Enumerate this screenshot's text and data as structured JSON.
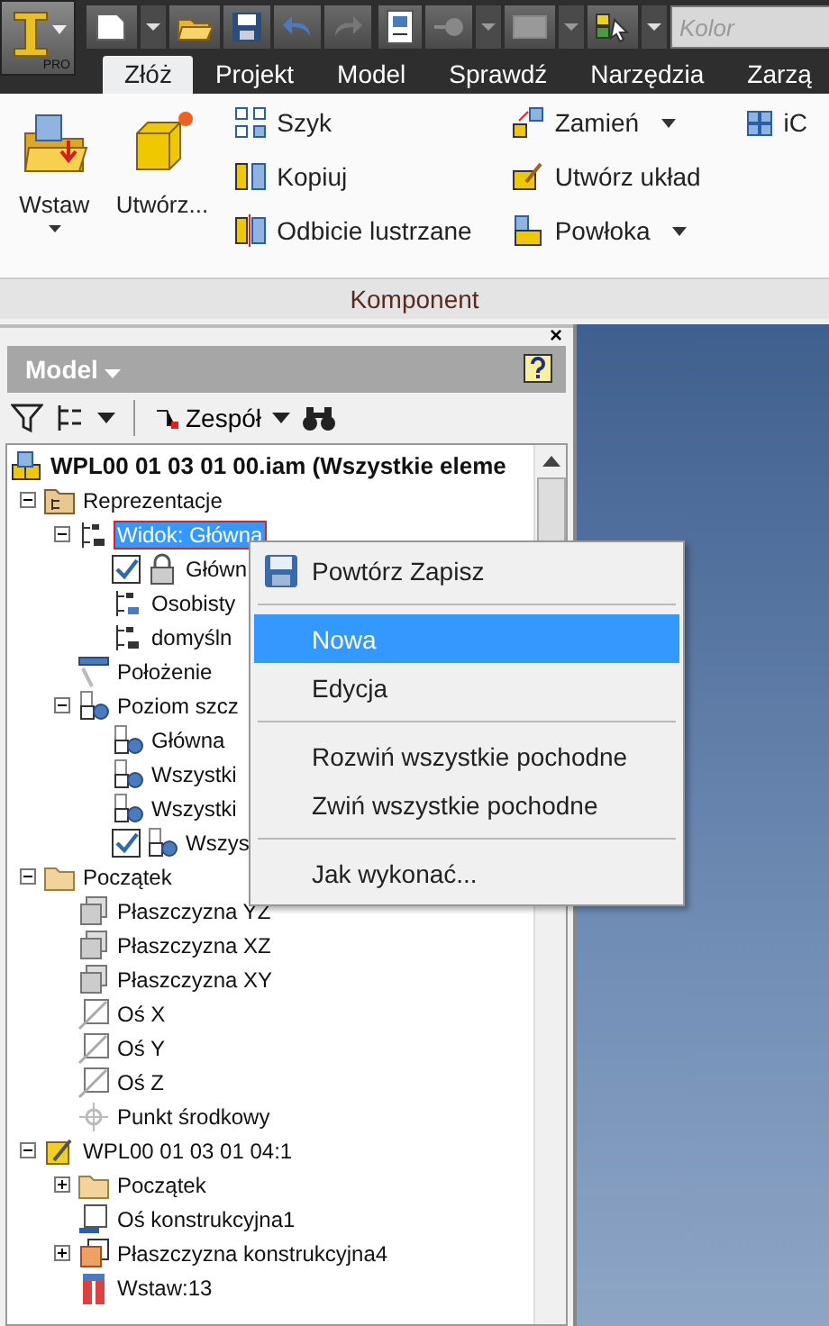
{
  "quick_access": {
    "color_field": {
      "placeholder": "Kolor"
    }
  },
  "app_button": {
    "label": "PRO"
  },
  "tabs": [
    {
      "label": "Złóż",
      "selected": true
    },
    {
      "label": "Projekt",
      "selected": false
    },
    {
      "label": "Model",
      "selected": false
    },
    {
      "label": "Sprawdź",
      "selected": false
    },
    {
      "label": "Narzędzia",
      "selected": false
    },
    {
      "label": "Zarzą",
      "selected": false
    }
  ],
  "ribbon": {
    "large_buttons": [
      {
        "label": "Wstaw",
        "dropdown": true,
        "kind": "insert"
      },
      {
        "label": "Utwórz...",
        "dropdown": false,
        "kind": "create"
      }
    ],
    "small_columns": [
      [
        {
          "label": "Szyk",
          "dropdown": false,
          "kind": "pattern"
        },
        {
          "label": "Kopiuj",
          "dropdown": false,
          "kind": "copy"
        },
        {
          "label": "Odbicie lustrzane",
          "dropdown": false,
          "kind": "mirror"
        }
      ],
      [
        {
          "label": "Zamień",
          "dropdown": true,
          "kind": "replace"
        },
        {
          "label": "Utwórz układ",
          "dropdown": false,
          "kind": "layout"
        },
        {
          "label": "Powłoka",
          "dropdown": true,
          "kind": "shell"
        }
      ],
      [
        {
          "label": "iC",
          "dropdown": false,
          "kind": "ic"
        }
      ]
    ],
    "panel_title": "Komponent"
  },
  "browser": {
    "title": "Model",
    "close": "×",
    "toolbar": {
      "mode": "Zespół"
    },
    "tree": {
      "label": "WPL00 01 03 01 00.iam (Wszystkie eleme",
      "kind": "assembly",
      "selected": false,
      "children": [
        {
          "label": "Reprezentacje",
          "kind": "reps",
          "selected": false,
          "expanded": true,
          "children": [
            {
              "label": "Widok: Główna",
              "kind": "view",
              "selected": true,
              "expanded": true,
              "children": [
                {
                  "label": "Główn",
                  "kind": "lock",
                  "selected": false,
                  "checked": true
                },
                {
                  "label": "Osobisty",
                  "kind": "view-user",
                  "selected": false
                },
                {
                  "label": "domyśln",
                  "kind": "view",
                  "selected": false
                }
              ]
            },
            {
              "label": "Położenie",
              "kind": "position",
              "selected": false
            },
            {
              "label": "Poziom szcz",
              "kind": "level",
              "selected": false,
              "expanded": true,
              "children": [
                {
                  "label": "Główna",
                  "kind": "level",
                  "selected": false
                },
                {
                  "label": "Wszystki",
                  "kind": "level",
                  "selected": false
                },
                {
                  "label": "Wszystki",
                  "kind": "level",
                  "selected": false
                },
                {
                  "label": "Wszys",
                  "kind": "level",
                  "selected": false,
                  "checked": true
                }
              ]
            }
          ]
        },
        {
          "label": "Początek",
          "kind": "folder",
          "selected": false,
          "expanded": true,
          "children": [
            {
              "label": "Płaszczyzna YZ",
              "kind": "plane",
              "selected": false
            },
            {
              "label": "Płaszczyzna XZ",
              "kind": "plane",
              "selected": false
            },
            {
              "label": "Płaszczyzna XY",
              "kind": "plane",
              "selected": false
            },
            {
              "label": "Oś X",
              "kind": "axis",
              "selected": false
            },
            {
              "label": "Oś Y",
              "kind": "axis",
              "selected": false
            },
            {
              "label": "Oś Z",
              "kind": "axis",
              "selected": false
            },
            {
              "label": "Punkt środkowy",
              "kind": "point",
              "selected": false
            }
          ]
        },
        {
          "label": "WPL00 01 03 01 04:1",
          "kind": "part",
          "selected": false,
          "expanded": true,
          "children": [
            {
              "label": "Początek",
              "kind": "folder",
              "selected": false,
              "expanded": false
            },
            {
              "label": "Oś konstrukcyjna1",
              "kind": "work-axis",
              "selected": false
            },
            {
              "label": "Płaszczyzna konstrukcyjna4",
              "kind": "work-plane",
              "selected": false,
              "expanded": false
            },
            {
              "label": "Wstaw:13",
              "kind": "insert",
              "selected": false
            }
          ]
        }
      ]
    }
  },
  "context_menu": {
    "groups": [
      [
        {
          "label": "Powtórz Zapisz",
          "kind": "icon-item",
          "selected": false
        }
      ],
      [
        {
          "label": "Nowa",
          "kind": "item",
          "selected": true
        },
        {
          "label": "Edycja",
          "kind": "item",
          "selected": false
        }
      ],
      [
        {
          "label": "Rozwiń wszystkie pochodne",
          "kind": "item",
          "selected": false
        },
        {
          "label": "Zwiń wszystkie pochodne",
          "kind": "item",
          "selected": false
        }
      ],
      [
        {
          "label": "Jak wykonać...",
          "kind": "item",
          "selected": false
        }
      ]
    ]
  }
}
